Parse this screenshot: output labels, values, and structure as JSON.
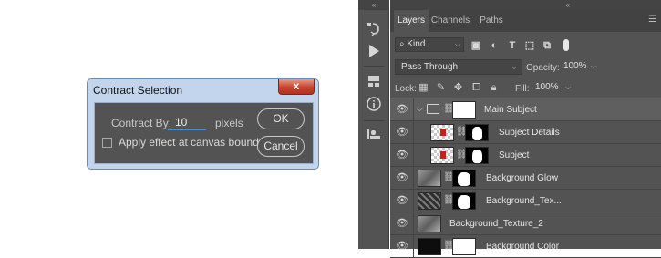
{
  "dialog": {
    "title": "Contract Selection",
    "close_label": "x",
    "contract_label": "Contract By:",
    "contract_value": "10",
    "unit": "pixels",
    "checkbox_label": "Apply effect at canvas bounds",
    "checkbox_checked": false,
    "ok_label": "OK",
    "cancel_label": "Cancel"
  },
  "toolbar": {
    "collapse": "«",
    "icons": [
      "history-icon",
      "play-icon",
      "adjustments-icon",
      "info-icon",
      "clone-source-icon"
    ]
  },
  "panel": {
    "collapse": "«",
    "tabs": [
      "Layers",
      "Channels",
      "Paths"
    ],
    "active_tab": "Layers",
    "filter_kind": "Kind",
    "blend_mode": "Pass Through",
    "opacity_label": "Opacity:",
    "opacity_value": "100%",
    "lock_label": "Lock:",
    "fill_label": "Fill:",
    "fill_value": "100%",
    "layers": [
      {
        "name": "Main Subject",
        "type": "group",
        "selected": true
      },
      {
        "name": "Subject Details",
        "type": "layer",
        "indent": true
      },
      {
        "name": "Subject",
        "type": "layer",
        "indent": true
      },
      {
        "name": "Background Glow",
        "type": "layer"
      },
      {
        "name": "Background_Tex...",
        "type": "layer"
      },
      {
        "name": "Background_Texture_2",
        "type": "layer"
      },
      {
        "name": "Background Color",
        "type": "layer"
      }
    ]
  },
  "colors": {
    "panel_bg": "#535353",
    "tab_bar": "#424242",
    "dialog_frame": "#c2d5ec",
    "close_button": "#c7422c",
    "input_underline": "#4a90d9"
  }
}
